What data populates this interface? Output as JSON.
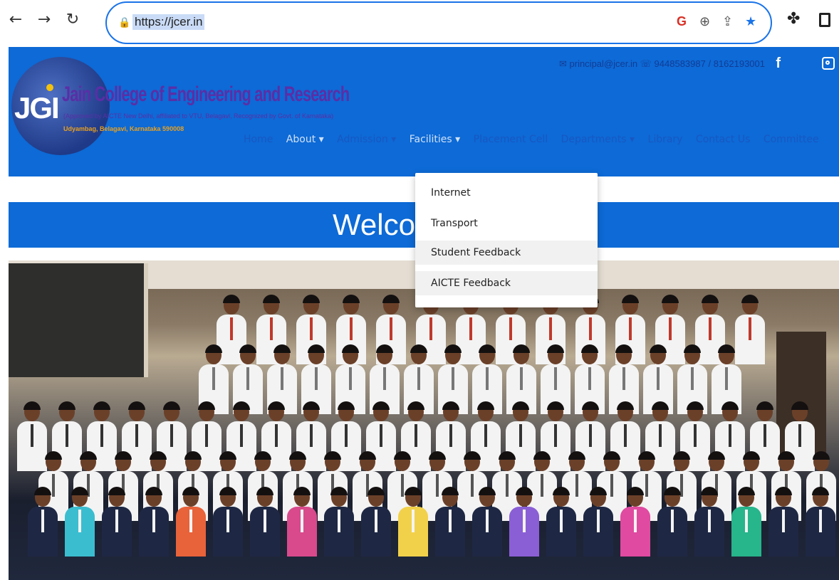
{
  "browser": {
    "url": "https://jcer.in",
    "icons": [
      "back-icon",
      "forward-icon",
      "reload-icon",
      "lock-icon",
      "google-icon",
      "zoom-icon",
      "share-icon",
      "star-icon",
      "extensions-icon",
      "sidepanel-icon"
    ]
  },
  "header": {
    "logo_text": "JGI",
    "college_name": "Jain College of Engineering and Research",
    "college_sub": "(Approved by AICTE New Delhi, affiliated to VTU, Belagavi, Recognized by Govt. of Karnataka)",
    "college_addr": "Udyambag, Belagavi, Karnataka 590008",
    "contact": "✉ principal@jcer.in  ☏ 9448583987 / 8162193001",
    "social": [
      "facebook-icon",
      "instagram-icon"
    ]
  },
  "menu": {
    "items": [
      "Home",
      "About ▾",
      "Admission ▾",
      "Facilities ▾",
      "Placement Cell",
      "Departments ▾",
      "Library",
      "Contact Us",
      "Committee"
    ]
  },
  "dropdown": {
    "items": [
      "Internet",
      "Transport",
      "Student Feedback",
      "AICTE Feedback"
    ]
  },
  "welcome": {
    "text": "Welco"
  },
  "colors": {
    "brand_blue": "#0d6ad6",
    "focus_blue": "#1a73e8"
  }
}
